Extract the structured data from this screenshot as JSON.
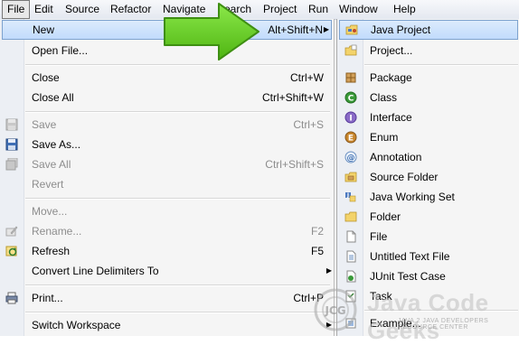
{
  "menubar": {
    "items": [
      "File",
      "Edit",
      "Source",
      "Refactor",
      "Navigate",
      "Search",
      "Project",
      "Run",
      "Window",
      "Help"
    ],
    "visible_labels": [
      "File",
      "Edit",
      "Source",
      "Refactor",
      "Navigate",
      "earch",
      "Project",
      "Run",
      "Window",
      "Help"
    ]
  },
  "file_menu": {
    "items": [
      {
        "label": "New",
        "shortcut": "Alt+Shift+N",
        "submenu": true,
        "highlighted": true
      },
      {
        "label": "Open File...",
        "shortcut": ""
      },
      {
        "label": "Close",
        "shortcut": "Ctrl+W"
      },
      {
        "label": "Close All",
        "shortcut": "Ctrl+Shift+W"
      },
      {
        "label": "Save",
        "shortcut": "Ctrl+S",
        "disabled": true
      },
      {
        "label": "Save As...",
        "shortcut": ""
      },
      {
        "label": "Save All",
        "shortcut": "Ctrl+Shift+S",
        "disabled": true
      },
      {
        "label": "Revert",
        "shortcut": "",
        "disabled": true
      },
      {
        "label": "Move...",
        "shortcut": "",
        "disabled": true
      },
      {
        "label": "Rename...",
        "shortcut": "F2",
        "disabled": true
      },
      {
        "label": "Refresh",
        "shortcut": "F5"
      },
      {
        "label": "Convert Line Delimiters To",
        "shortcut": "",
        "submenu": true
      },
      {
        "label": "Print...",
        "shortcut": "Ctrl+P"
      },
      {
        "label": "Switch Workspace",
        "shortcut": "",
        "submenu": true
      }
    ]
  },
  "new_submenu": {
    "items": [
      {
        "label": "Java Project",
        "icon": "java-project-icon",
        "highlighted": true
      },
      {
        "label": "Project...",
        "icon": "project-icon"
      },
      {
        "label": "Package",
        "icon": "package-icon"
      },
      {
        "label": "Class",
        "icon": "class-icon"
      },
      {
        "label": "Interface",
        "icon": "interface-icon"
      },
      {
        "label": "Enum",
        "icon": "enum-icon"
      },
      {
        "label": "Annotation",
        "icon": "annotation-icon"
      },
      {
        "label": "Source Folder",
        "icon": "source-folder-icon"
      },
      {
        "label": "Java Working Set",
        "icon": "working-set-icon"
      },
      {
        "label": "Folder",
        "icon": "folder-icon"
      },
      {
        "label": "File",
        "icon": "file-icon"
      },
      {
        "label": "Untitled Text File",
        "icon": "text-file-icon"
      },
      {
        "label": "JUnit Test Case",
        "icon": "junit-icon"
      },
      {
        "label": "Task",
        "icon": "task-icon"
      },
      {
        "label": "Example...",
        "icon": "example-icon"
      }
    ]
  },
  "watermark": {
    "text": "Java Code Geeks",
    "subtitle": "JAVA 2 JAVA DEVELOPERS RESOURCE CENTER",
    "logo": "JCG"
  },
  "colors": {
    "highlight": "#c1dbfc",
    "highlight_border": "#7da2ce",
    "arrow": "#6ad21c",
    "disabled": "#8d8d8d"
  }
}
